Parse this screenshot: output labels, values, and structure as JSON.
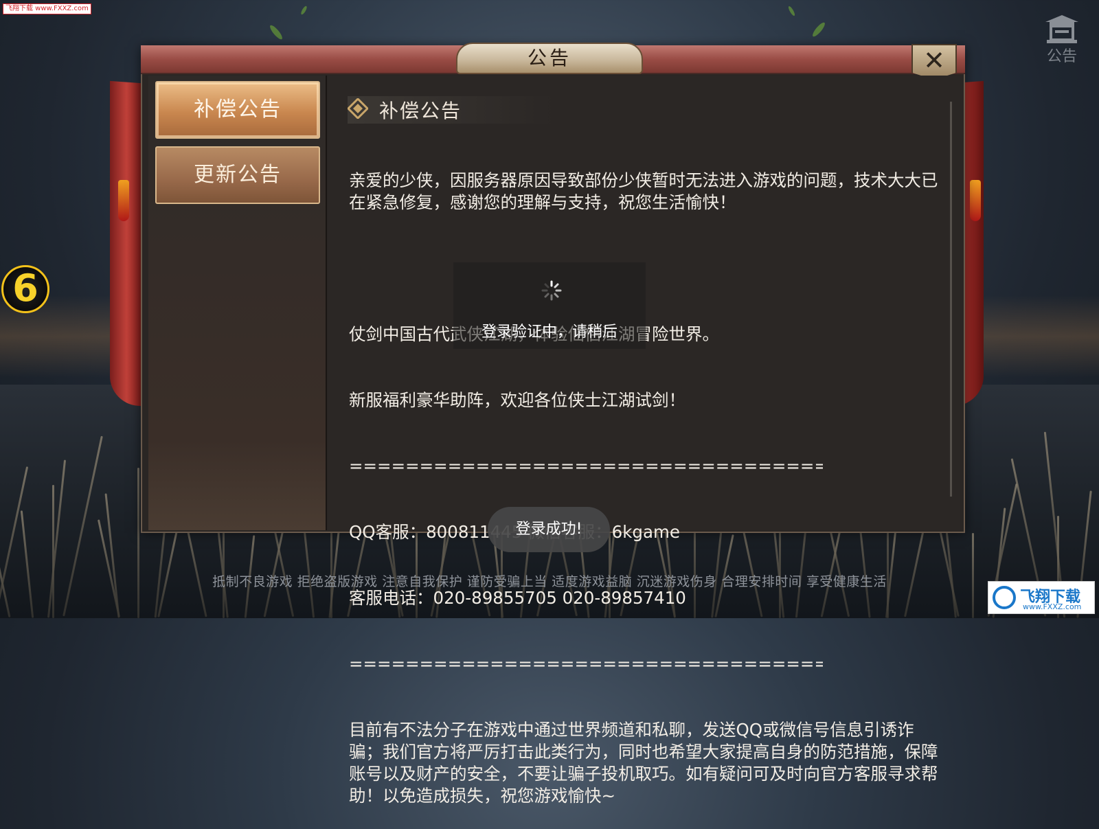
{
  "watermark_top_left": "飞翔下载 www.FXXZ.com",
  "top_right_notice_label": "公告",
  "left_badge": "6",
  "dialog": {
    "title": "公告",
    "close_icon": "close-icon",
    "tabs": [
      {
        "label": "补偿公告",
        "active": true
      },
      {
        "label": "更新公告",
        "active": false
      }
    ],
    "section_title": "补偿公告",
    "paragraphs": [
      "亲爱的少侠，因服务器原因导致部份少侠暂时无法进入游戏的问题，技术大大已在紧急修复，感谢您的理解与支持，祝您生活愉快！",
      "",
      "仗剑中国古代武侠江湖，体验仙侣江湖冒险世界。",
      "新服福利豪华助阵，欢迎各位侠士江湖试剑！",
      "============================================",
      "QQ客服：800811445 微信客服：6kgame",
      "客服电话：020-89855705 020-89857410",
      "============================================",
      "目前有不法分子在游戏中通过世界频道和私聊，发送QQ或微信号信息引诱诈骗；我们官方将严厉打击此类行为，同时也希望大家提高自身的防范措施，保障账号以及财产的安全，不要让骗子投机取巧。如有疑问可及时向官方客服寻求帮助！以免造成损失，祝您游戏愉快~"
    ]
  },
  "loading_text": "登录验证中，请稍后",
  "toast": "登录成功!",
  "footer": "抵制不良游戏 拒绝盗版游戏 注意自我保护 谨防受骗上当 适度游戏益脑 沉迷游戏伤身 合理安排时间 享受健康生活",
  "watermark_bottom_right": {
    "name": "飞翔下载",
    "url": "www.FXXZ.com"
  }
}
